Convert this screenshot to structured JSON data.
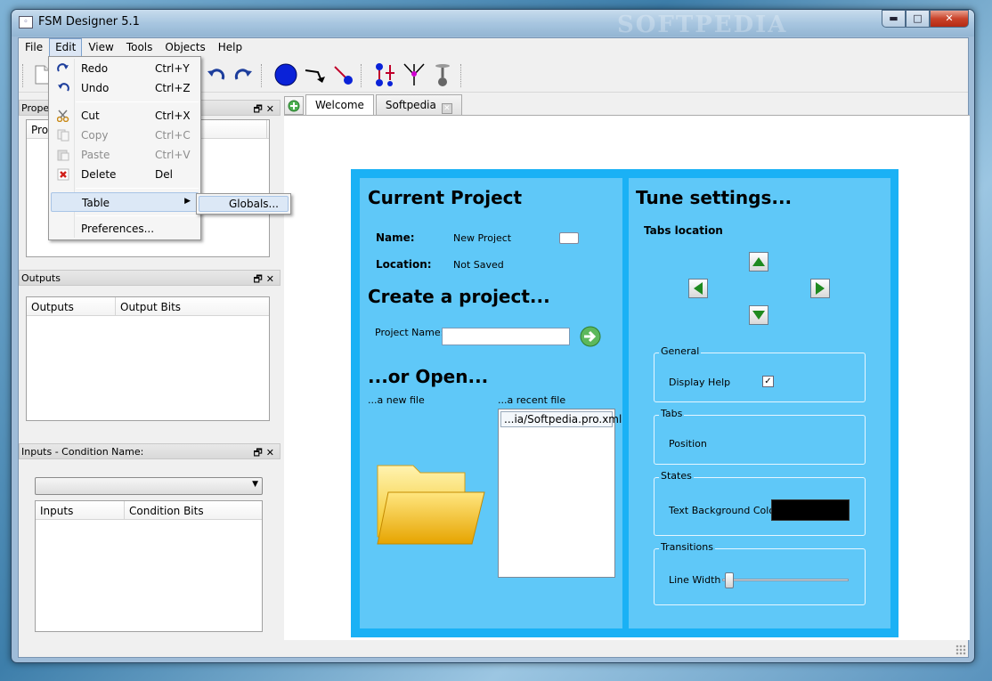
{
  "window": {
    "title": "FSM Designer 5.1",
    "watermark": "SOFTPEDIA"
  },
  "menubar": {
    "items": [
      "File",
      "Edit",
      "View",
      "Tools",
      "Objects",
      "Help"
    ],
    "active": "Edit"
  },
  "edit_menu": {
    "redo": {
      "label": "Redo",
      "shortcut": "Ctrl+Y"
    },
    "undo": {
      "label": "Undo",
      "shortcut": "Ctrl+Z"
    },
    "cut": {
      "label": "Cut",
      "shortcut": "Ctrl+X"
    },
    "copy": {
      "label": "Copy",
      "shortcut": "Ctrl+C"
    },
    "paste": {
      "label": "Paste",
      "shortcut": "Ctrl+V"
    },
    "delete": {
      "label": "Delete",
      "shortcut": "Del"
    },
    "table": {
      "label": "Table"
    },
    "preferences": {
      "label": "Preferences..."
    },
    "submenu_globals": "Globals..."
  },
  "docks": {
    "properties": {
      "title": "Proper",
      "column": "Prop"
    },
    "outputs": {
      "title": "Outputs",
      "columns": [
        "Outputs",
        "Output Bits"
      ]
    },
    "inputs": {
      "title": "Inputs - Condition Name:",
      "columns": [
        "Inputs",
        "Condition Bits"
      ]
    }
  },
  "tabs": [
    {
      "label": "Welcome"
    },
    {
      "label": "Softpedia"
    }
  ],
  "welcome": {
    "current_project": {
      "heading": "Current Project",
      "name_label": "Name:",
      "name_value": "New Project",
      "location_label": "Location:",
      "location_value": "Not Saved"
    },
    "create": {
      "heading": "Create a project...",
      "project_name_label": "Project Name:",
      "project_name_value": ""
    },
    "open": {
      "heading": "...or Open...",
      "new_file_label": "...a new file",
      "recent_file_label": "...a recent file",
      "recent_files": [
        "...ia/Softpedia.pro.xml"
      ]
    },
    "settings": {
      "heading": "Tune settings...",
      "tabs_location_label": "Tabs location",
      "general": {
        "title": "General",
        "display_help_label": "Display Help",
        "display_help_checked": "✓"
      },
      "tabs_group": {
        "title": "Tabs",
        "position_label": "Position"
      },
      "states": {
        "title": "States",
        "text_bg_label": "Text Background Color",
        "text_bg_color": "#000000"
      },
      "transitions": {
        "title": "Transitions",
        "line_width_label": "Line Width",
        "line_width_fraction": 0.02
      }
    }
  },
  "colors": {
    "welcome_frame": "#1ab1f5",
    "welcome_pane": "#5fc8f8",
    "menu_hover": "#dce8f6"
  }
}
